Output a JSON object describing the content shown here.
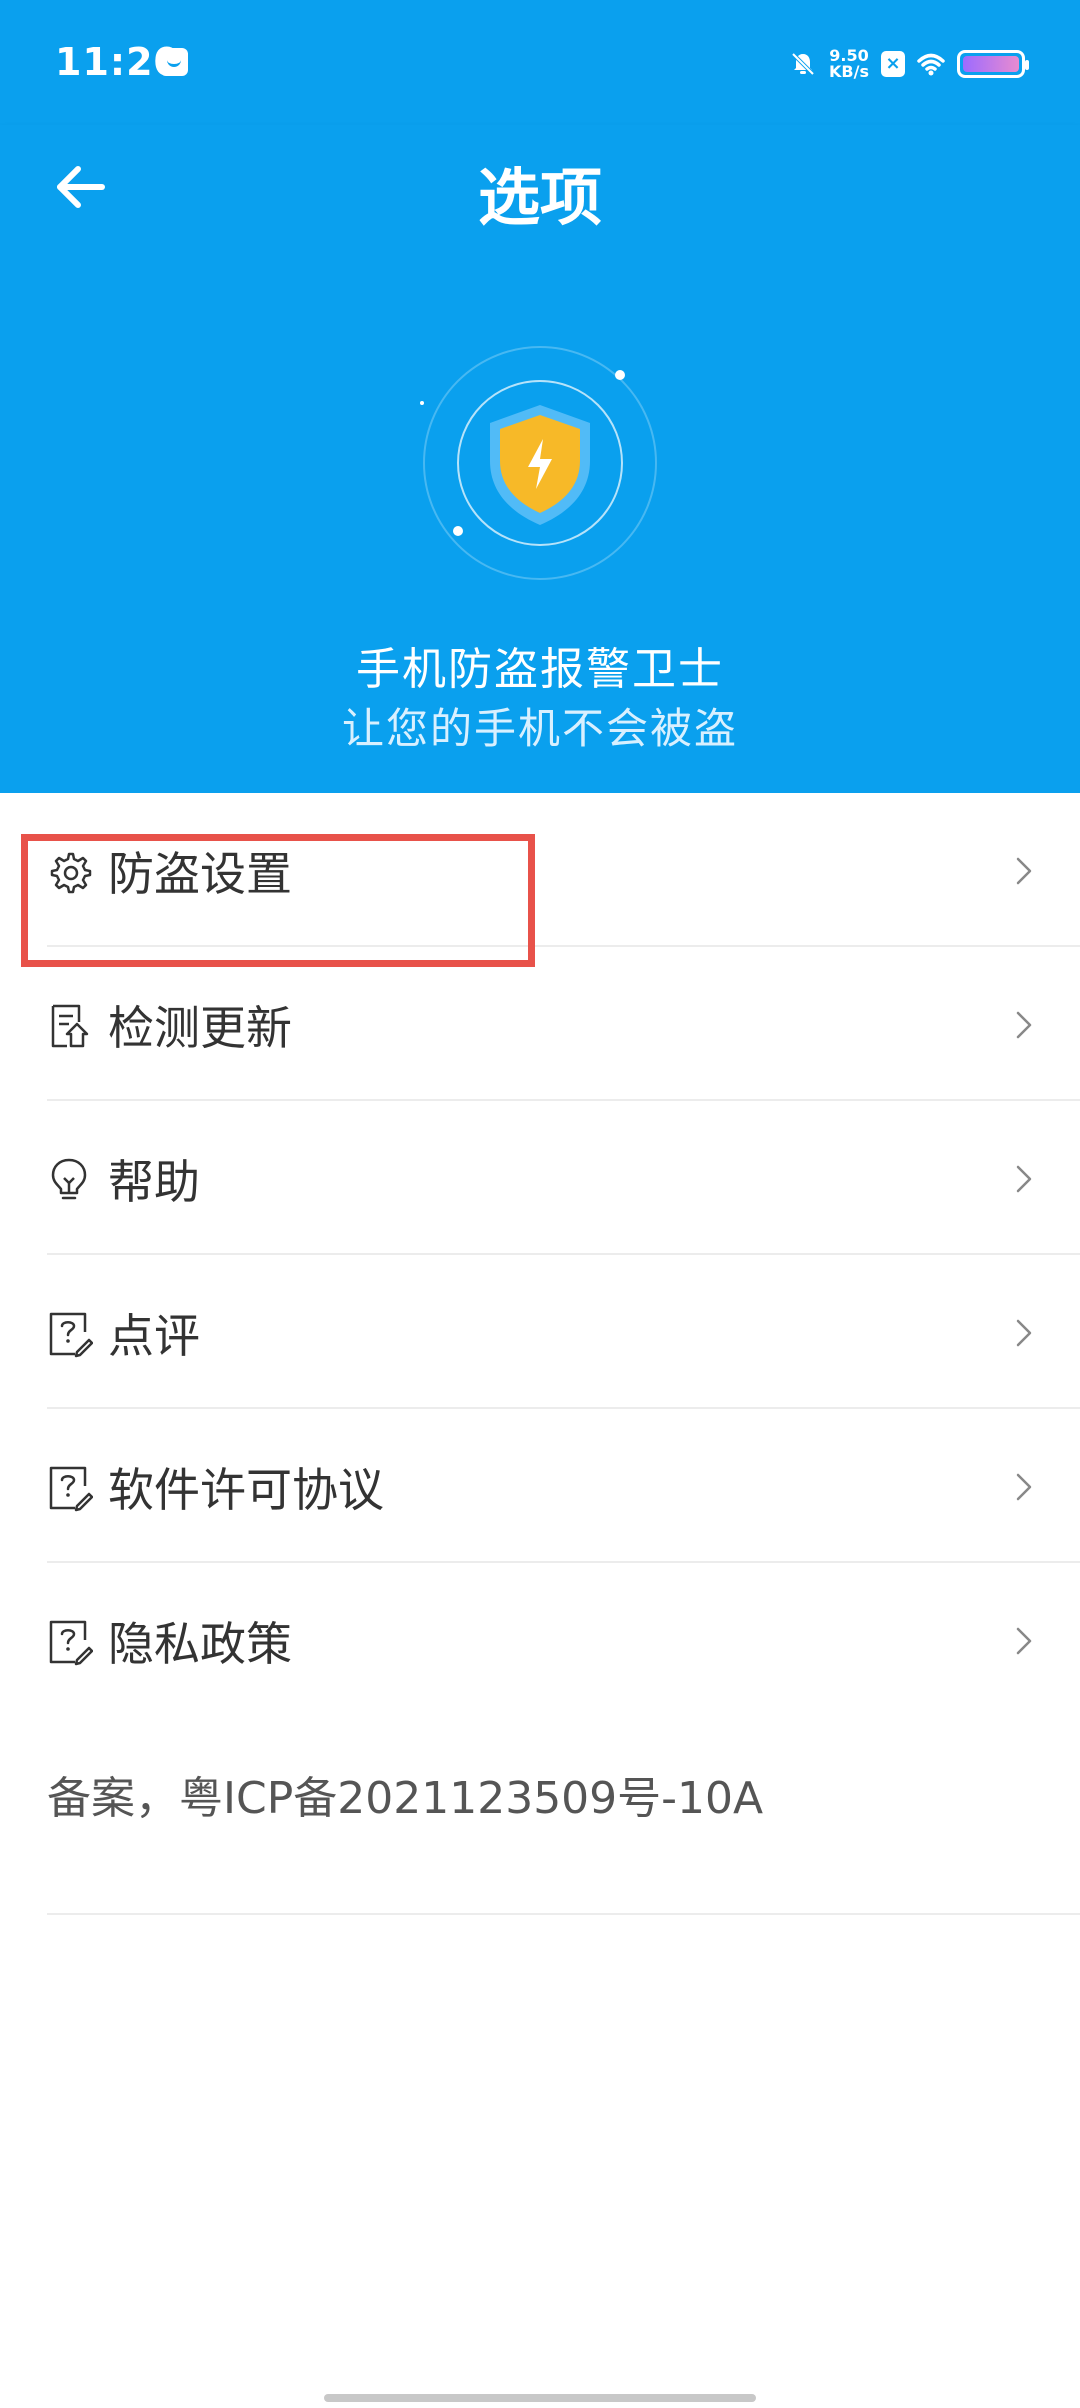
{
  "status_bar": {
    "time": "11:20",
    "speed_value": "9.50",
    "speed_unit": "KB/s",
    "x_badge": "×",
    "accent_color": "#0aa0ee"
  },
  "app_bar": {
    "title": "选项",
    "back_icon": "arrow-left-icon"
  },
  "hero": {
    "icon": "shield-lightning-icon",
    "title": "手机防盗报警卫士",
    "subtitle": "让您的手机不会被盗"
  },
  "menu": {
    "items": [
      {
        "label": "防盗设置",
        "icon": "gear-icon",
        "highlighted": true
      },
      {
        "label": "检测更新",
        "icon": "document-update-icon"
      },
      {
        "label": "帮助",
        "icon": "lightbulb-icon"
      },
      {
        "label": "点评",
        "icon": "question-edit-icon"
      },
      {
        "label": "软件许可协议",
        "icon": "question-edit-icon"
      },
      {
        "label": "隐私政策",
        "icon": "question-edit-icon"
      }
    ]
  },
  "footer": {
    "icp": "备案，粤ICP备2021123509号-10A"
  }
}
